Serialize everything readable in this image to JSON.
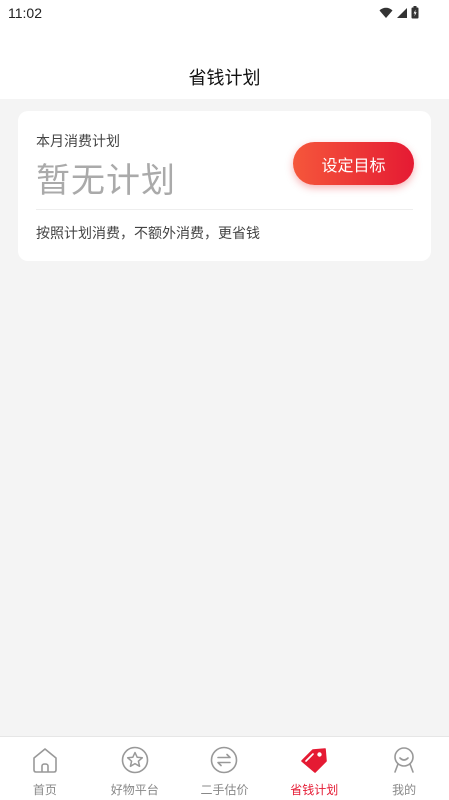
{
  "status_bar": {
    "time": "11:02",
    "icons": [
      "wifi-icon",
      "signal-icon",
      "battery-icon"
    ]
  },
  "header": {
    "title": "省钱计划"
  },
  "plan_card": {
    "label": "本月消费计划",
    "value": "暂无计划",
    "button_label": "设定目标",
    "tip": "按照计划消费，不额外消费，更省钱"
  },
  "tabs": [
    {
      "label": "首页",
      "icon": "home-icon",
      "active": false
    },
    {
      "label": "好物平台",
      "icon": "star-icon",
      "active": false
    },
    {
      "label": "二手估价",
      "icon": "exchange-icon",
      "active": false
    },
    {
      "label": "省钱计划",
      "icon": "tag-icon",
      "active": true
    },
    {
      "label": "我的",
      "icon": "profile-icon",
      "active": false
    }
  ],
  "colors": {
    "accent": "#e51a33",
    "accent_start": "#f5573b",
    "background": "#f4f4f4"
  }
}
